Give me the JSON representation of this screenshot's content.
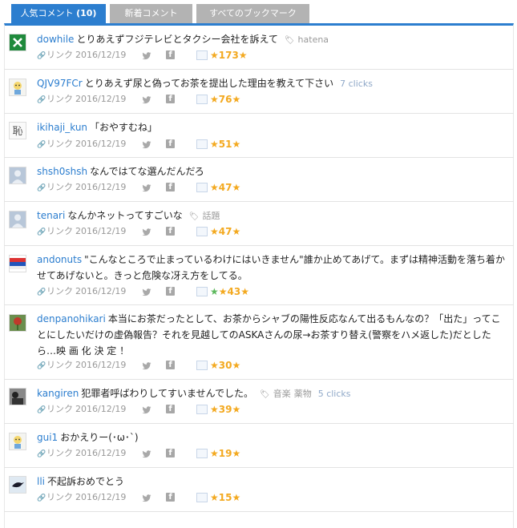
{
  "tabs": [
    {
      "label": "人気コメント",
      "count": "(10)"
    },
    {
      "label": "新着コメント"
    },
    {
      "label": "すべてのブックマーク"
    }
  ],
  "link_label": "リンク",
  "comments": [
    {
      "user": "dowhile",
      "text": "とりあえずフジテレビとタクシー会社を訴えて",
      "tags": [
        "hatena"
      ],
      "clicks": "",
      "date": "2016/12/19",
      "stars": "★173★",
      "green_star": false,
      "avatar": "x-icon"
    },
    {
      "user": "QJV97FCr",
      "text": "とりあえず尿と偽ってお茶を提出した理由を教えて下さい",
      "tags": [],
      "clicks": "7 clicks",
      "date": "2016/12/19",
      "stars": "★76★",
      "green_star": false,
      "avatar": "character-icon"
    },
    {
      "user": "ikihaji_kun",
      "text": "「おやすむね」",
      "tags": [],
      "clicks": "",
      "date": "2016/12/19",
      "stars": "★51★",
      "green_star": false,
      "avatar": "kanji-icon"
    },
    {
      "user": "shsh0shsh",
      "text": "なんではてな選んだんだろ",
      "tags": [],
      "clicks": "",
      "date": "2016/12/19",
      "stars": "★47★",
      "green_star": false,
      "avatar": "default-user-icon"
    },
    {
      "user": "tenari",
      "text": "なんかネットってすごいな",
      "tags": [
        "話題"
      ],
      "clicks": "",
      "date": "2016/12/19",
      "stars": "★47★",
      "green_star": false,
      "avatar": "default-user-icon"
    },
    {
      "user": "andonuts",
      "text": "\"こんなところで止まっているわけにはいきません\"誰か止めてあげて。まずは精神活動を落ち着かせてあげないと。きっと危険な冴え方をしてる。",
      "tags": [],
      "clicks": "",
      "date": "2016/12/19",
      "stars": "★43★",
      "green_star": true,
      "avatar": "flag-icon"
    },
    {
      "user": "denpanohikari",
      "text": "本当にお茶だったとして、お茶からシャブの陽性反応なんて出るもんなの？「出た」ってことにしたいだけの虚偽報告？それを見越してのASKAさんの尿→お茶すり替え(警察をハメ返した)だとしたら…映 画 化 決 定 ！",
      "tags": [],
      "clicks": "",
      "date": "2016/12/19",
      "stars": "★30★",
      "green_star": false,
      "avatar": "flower-icon"
    },
    {
      "user": "kangiren",
      "text": "犯罪者呼ばわりしてすいませんでした。",
      "tags": [
        "音楽",
        "薬物"
      ],
      "clicks": "5 clicks",
      "date": "2016/12/19",
      "stars": "★39★",
      "green_star": false,
      "avatar": "photo-icon"
    },
    {
      "user": "gui1",
      "text": "おかえりー(･ω･`)",
      "tags": [],
      "clicks": "",
      "date": "2016/12/19",
      "stars": "★19★",
      "green_star": false,
      "avatar": "character-icon"
    },
    {
      "user": "lli",
      "text": "不起訴おめでとう",
      "tags": [],
      "clicks": "",
      "date": "2016/12/19",
      "stars": "★15★",
      "green_star": false,
      "avatar": "bird-icon"
    }
  ],
  "colors": {
    "accent": "#2c7ecf",
    "star": "#f3a920",
    "green_star": "#5cb85c",
    "tab_inactive": "#b3b3b3"
  }
}
